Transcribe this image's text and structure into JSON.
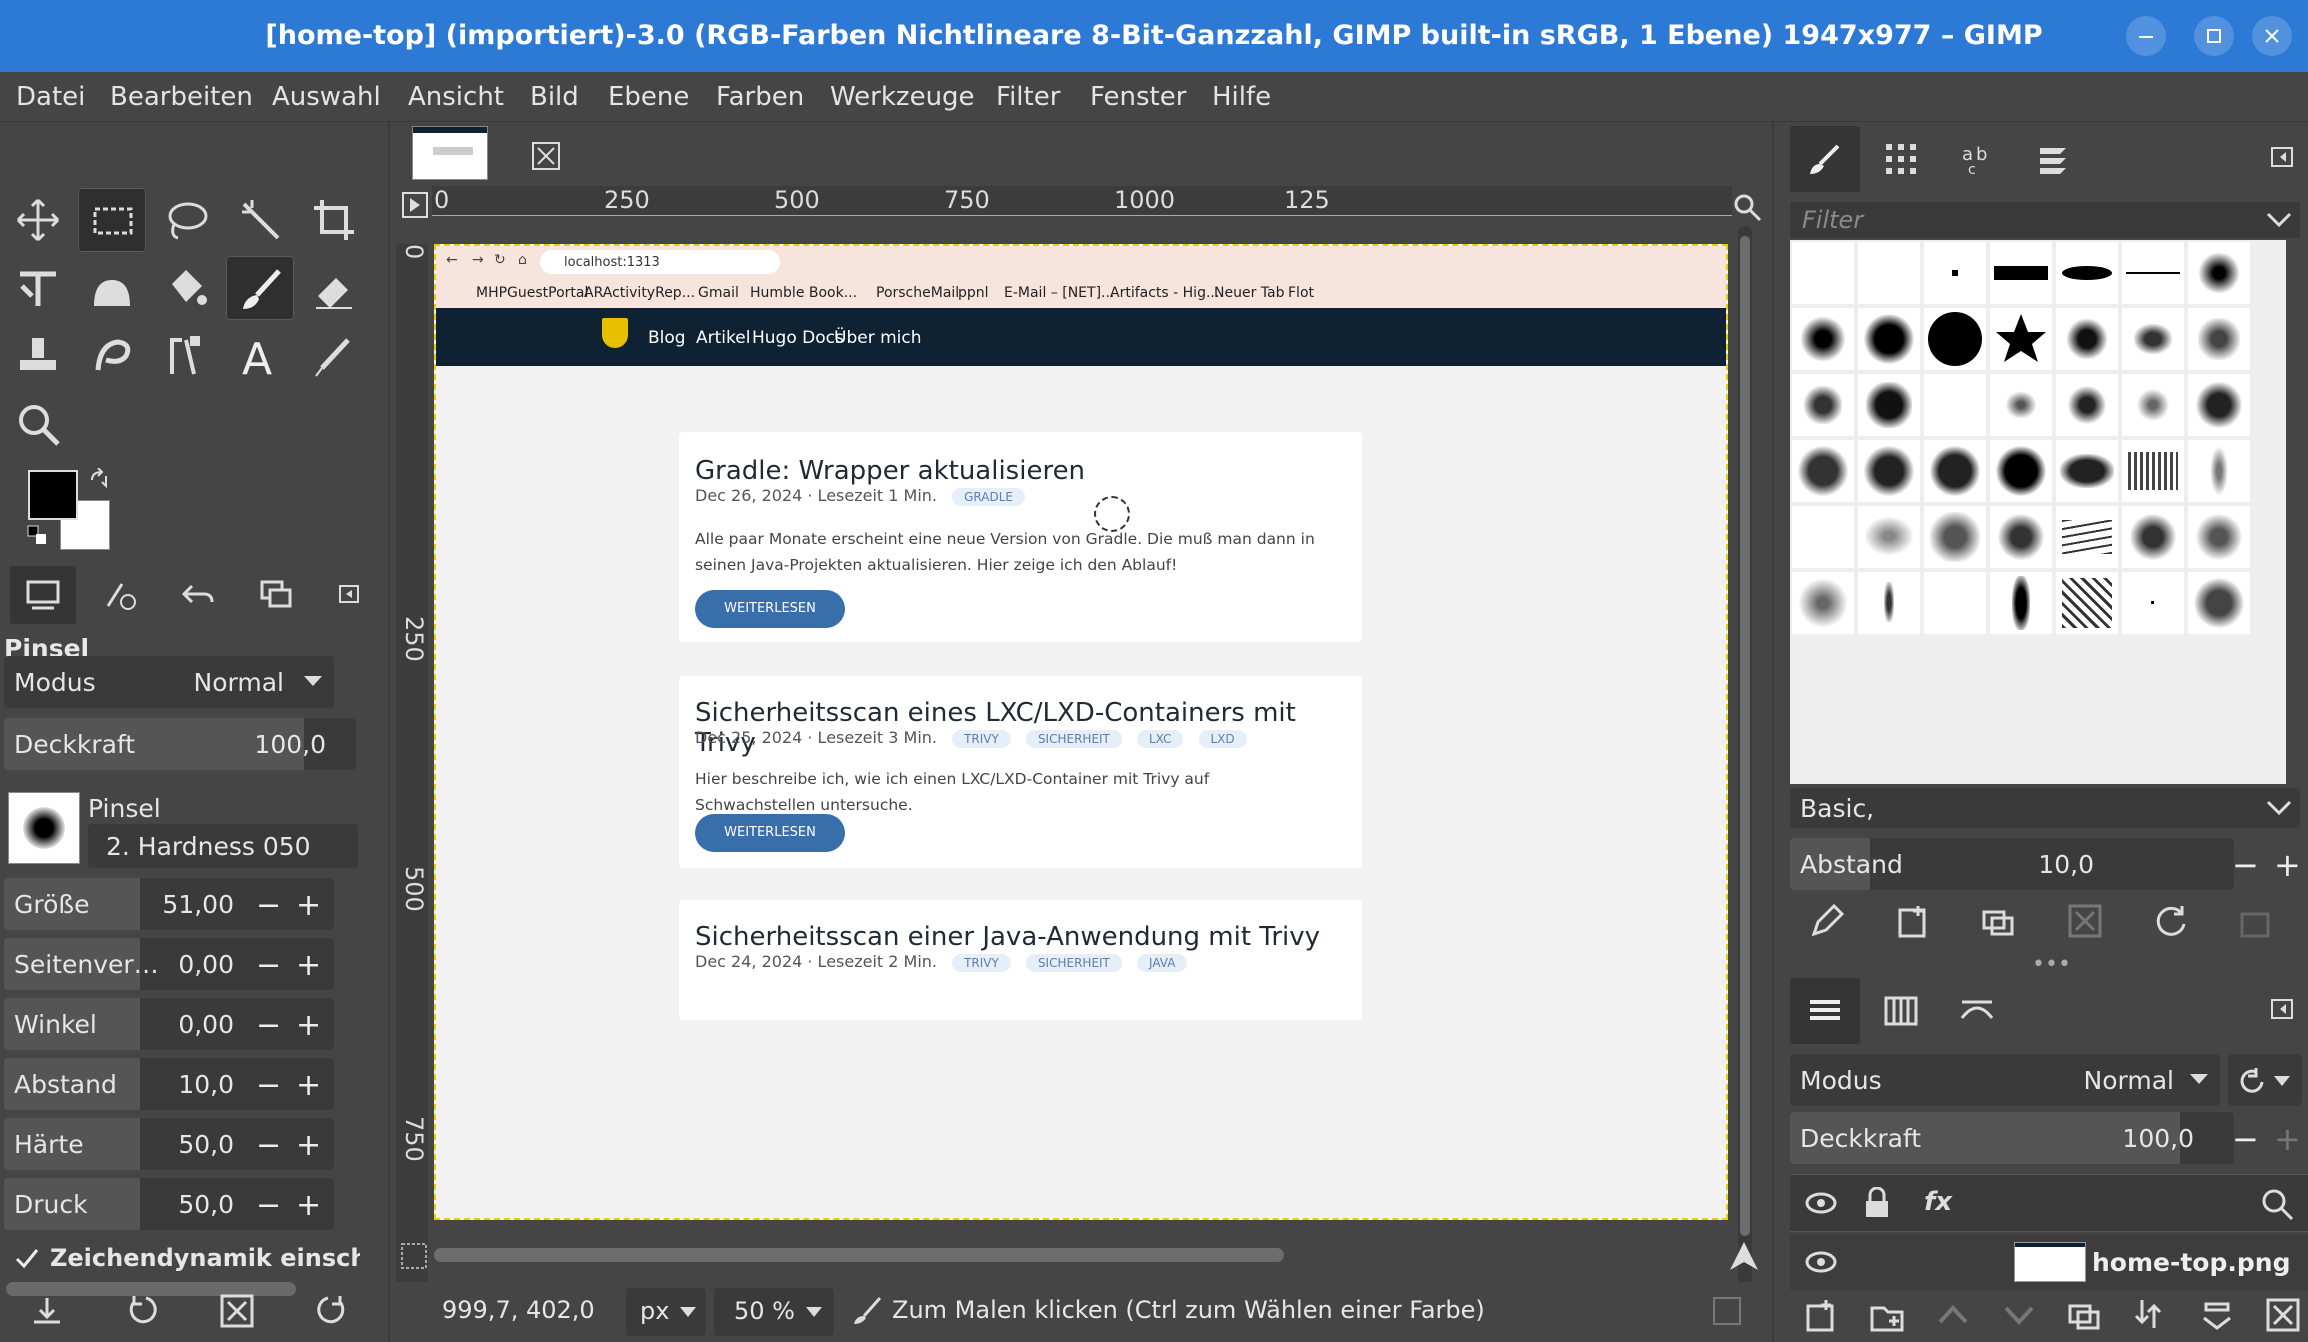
{
  "window": {
    "title": "[home-top] (importiert)-3.0 (RGB-Farben Nichtlineare 8-Bit-Ganzzahl, GIMP built-in sRGB, 1 Ebene) 1947x977 – GIMP"
  },
  "menu": [
    "Datei",
    "Bearbeiten",
    "Auswahl",
    "Ansicht",
    "Bild",
    "Ebene",
    "Farben",
    "Werkzeuge",
    "Filter",
    "Fenster",
    "Hilfe"
  ],
  "tool_options": {
    "section_title": "Pinsel",
    "mode_label": "Modus",
    "mode_value": "Normal",
    "opacity_label": "Deckkraft",
    "opacity_value": "100,0",
    "brush_label": "Pinsel",
    "brush_name": "2. Hardness 050",
    "size_label": "Größe",
    "size_value": "51,00",
    "aspect_label": "Seitenver…",
    "aspect_value": "0,00",
    "angle_label": "Winkel",
    "angle_value": "0,00",
    "spacing_label": "Abstand",
    "spacing_value": "10,0",
    "hardness_label": "Härte",
    "hardness_value": "50,0",
    "force_label": "Druck",
    "force_value": "50,0",
    "dynamics_label": "Zeichendynamik einscha"
  },
  "rulers": {
    "h_ticks": [
      "0",
      "250",
      "500",
      "750",
      "1000",
      "125"
    ],
    "v_ticks": [
      "0",
      "250",
      "500",
      "750"
    ]
  },
  "webpage": {
    "url": "localhost:1313",
    "bookmarks": [
      "MHPGuestPortal",
      "ARActivityRep...",
      "Gmail",
      "Humble Book...",
      "PorscheMail",
      "ppnl",
      "E-Mail – [NET]...",
      "Artifacts - Hig...",
      "Neuer Tab",
      "Flot"
    ],
    "nav": [
      "Blog",
      "Artikel",
      "Hugo Docs",
      "Über mich"
    ],
    "posts": [
      {
        "title": "Gradle: Wrapper aktualisieren",
        "meta": "Dec 26, 2024 · Lesezeit 1 Min.",
        "tags": [
          "GRADLE"
        ],
        "excerpt": "Alle paar Monate erscheint eine neue Version von Gradle. Die muß man dann in seinen Java-Projekten aktualisieren. Hier zeige ich den Ablauf!",
        "button": "WEITERLESEN"
      },
      {
        "title": "Sicherheitsscan eines LXC/LXD-Containers mit Trivy",
        "meta": "Dec 25, 2024 · Lesezeit 3 Min.",
        "tags": [
          "TRIVY",
          "SICHERHEIT",
          "LXC",
          "LXD"
        ],
        "excerpt": "Hier beschreibe ich, wie ich einen LXC/LXD-Container mit Trivy auf Schwachstellen untersuche.",
        "button": "WEITERLESEN"
      },
      {
        "title": "Sicherheitsscan einer Java-Anwendung mit Trivy",
        "meta": "Dec 24, 2024 · Lesezeit 2 Min.",
        "tags": [
          "TRIVY",
          "SICHERHEIT",
          "JAVA"
        ],
        "excerpt": "",
        "button": ""
      }
    ]
  },
  "status": {
    "coords": "999,7, 402,0",
    "unit": "px",
    "zoom": "50 %",
    "hint": "Zum Malen klicken (Ctrl zum Wählen einer Farbe)"
  },
  "brushes_panel": {
    "filter_placeholder": "Filter",
    "preset": "Basic,",
    "spacing_label": "Abstand",
    "spacing_value": "10,0"
  },
  "layers_panel": {
    "mode_label": "Modus",
    "mode_value": "Normal",
    "opacity_label": "Deckkraft",
    "opacity_value": "100,0",
    "layer_name": "home-top.png"
  },
  "colors": {
    "titlebar": "#2d79d6",
    "ui_bg": "#454545",
    "accent_button": "#386ea9",
    "selection": "#e8d000"
  }
}
